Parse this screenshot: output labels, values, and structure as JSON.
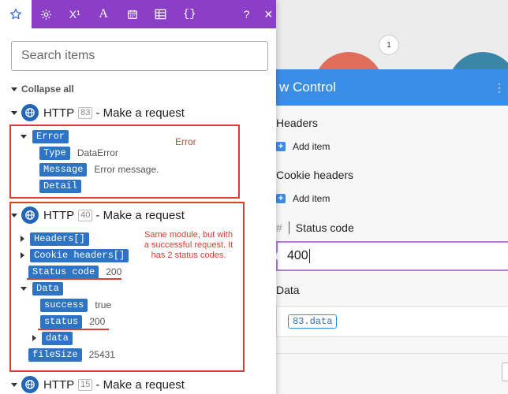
{
  "canvas": {
    "counter_badge": "1"
  },
  "right_panel": {
    "title": "w Control",
    "headers_label": "Headers",
    "headers_add": "Add item",
    "cookie_label": "Cookie headers",
    "cookie_add": "Add item",
    "status_code_label": "Status code",
    "status_code_value": "400",
    "data_label": "Data",
    "data_pill": "83.data"
  },
  "left_panel": {
    "tabs": [
      {
        "icon": "star-icon",
        "active": true
      },
      {
        "icon": "gear-icon"
      },
      {
        "icon": "superscript-icon",
        "text": "X¹"
      },
      {
        "icon": "text-icon",
        "text": "A"
      },
      {
        "icon": "calendar-icon"
      },
      {
        "icon": "table-icon"
      },
      {
        "icon": "braces-icon",
        "text": "{}"
      },
      {
        "icon": "help-icon",
        "text": "?"
      },
      {
        "icon": "close-icon",
        "text": "✕"
      }
    ],
    "search_placeholder": "Search items",
    "collapse_all": "Collapse all",
    "modules": [
      {
        "name": "HTTP",
        "id": "83",
        "action": "- Make a request"
      },
      {
        "name": "HTTP",
        "id": "40",
        "action": "- Make a request"
      },
      {
        "name": "HTTP",
        "id": "15",
        "action": "- Make a request"
      }
    ],
    "error_tree": {
      "error": "Error",
      "type_key": "Type",
      "type_val": "DataError",
      "message_key": "Message",
      "message_val": "Error message.",
      "detail_key": "Detail"
    },
    "success_tree": {
      "headers": "Headers[]",
      "cookie_headers": "Cookie headers[]",
      "status_code_key": "Status code",
      "status_code_val": "200",
      "data": "Data",
      "success_key": "success",
      "success_val": "true",
      "status_key": "status",
      "status_val": "200",
      "data_key": "data",
      "filesize_key": "fileSize",
      "filesize_val": "25431"
    }
  },
  "annotations": {
    "error_note": "Error",
    "success_note_1": "Same module, but with",
    "success_note_2": "a successful request. It",
    "success_note_3": "has 2 status codes.",
    "color": "#d8402f"
  },
  "colors": {
    "tab_bar": "#8a3fc6",
    "pill": "#2d74c4",
    "header_blue": "#3b8ee6"
  }
}
